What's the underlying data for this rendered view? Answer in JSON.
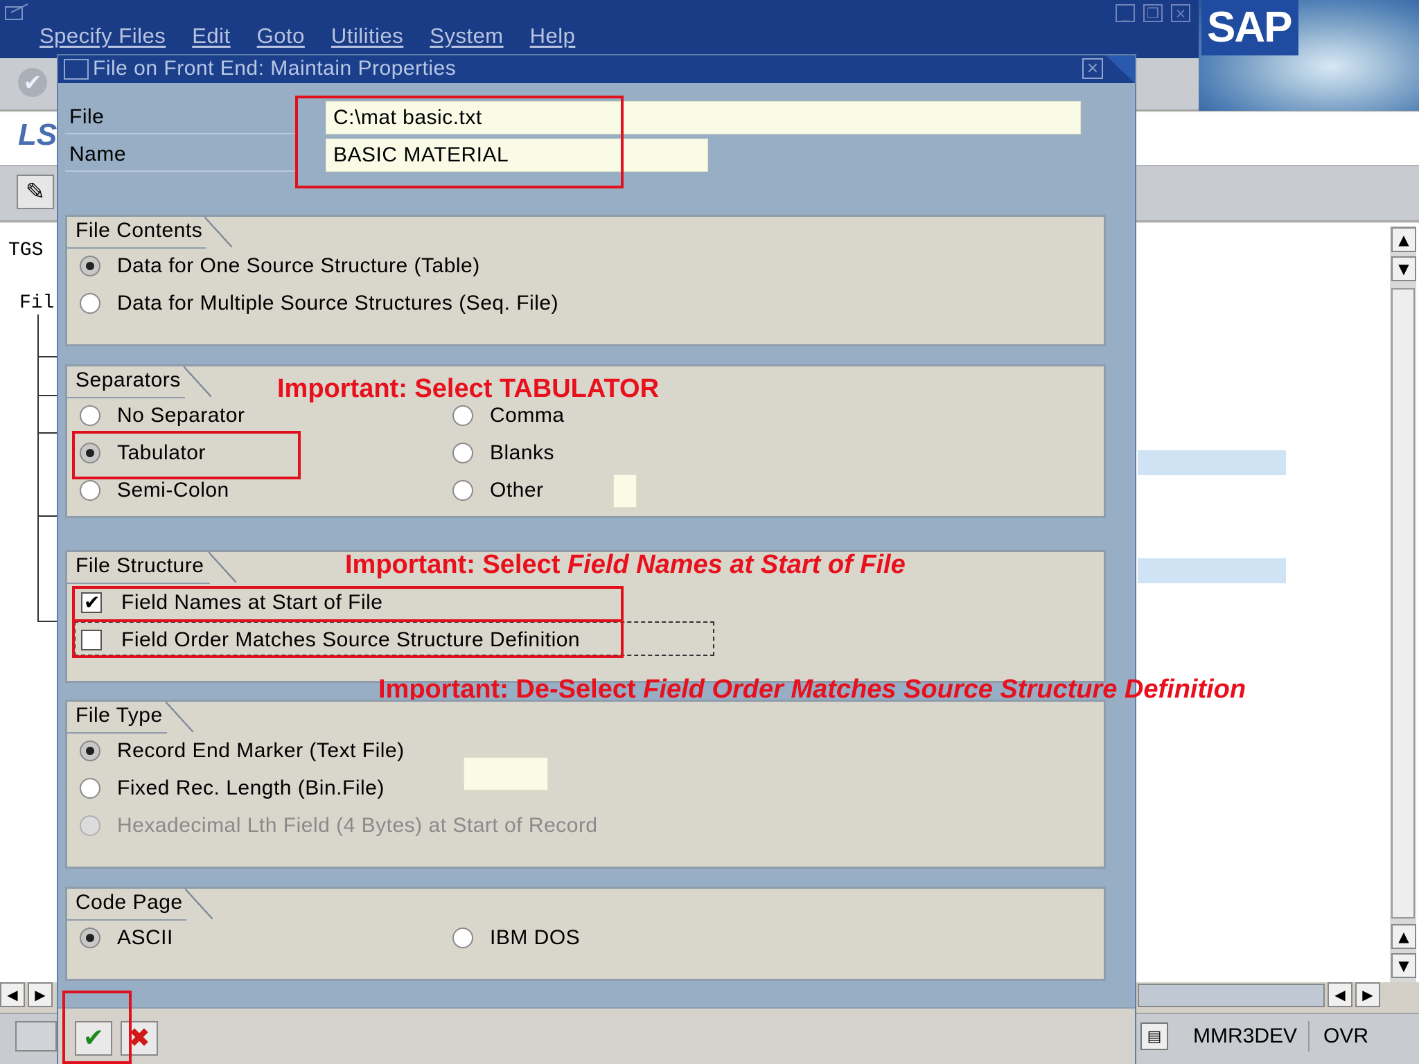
{
  "menu": [
    "Specify Files",
    "Edit",
    "Goto",
    "Utilities",
    "System",
    "Help"
  ],
  "window_controls": [
    "minimize",
    "restore",
    "close"
  ],
  "logo": "SAP",
  "background": {
    "program_title": "LS",
    "tree_label_1": "TGS",
    "tree_label_2": "Fil"
  },
  "dialog": {
    "title": "File on Front End: Maintain Properties",
    "file_label": "File",
    "file_value": "C:\\mat basic.txt",
    "name_label": "Name",
    "name_value": "BASIC MATERIAL",
    "file_contents": {
      "title": "File Contents",
      "options": [
        {
          "label": "Data for One Source Structure (Table)",
          "selected": true
        },
        {
          "label": "Data for Multiple Source Structures (Seq. File)",
          "selected": false
        }
      ]
    },
    "separators": {
      "title": "Separators",
      "options": [
        {
          "label": "No Separator",
          "selected": false
        },
        {
          "label": "Tabulator",
          "selected": true
        },
        {
          "label": "Semi-Colon",
          "selected": false
        },
        {
          "label": "Comma",
          "selected": false
        },
        {
          "label": "Blanks",
          "selected": false
        },
        {
          "label": "Other",
          "selected": false
        }
      ]
    },
    "file_structure": {
      "title": "File Structure",
      "options": [
        {
          "label": "Field Names at Start of File",
          "checked": true
        },
        {
          "label": "Field Order Matches Source Structure Definition",
          "checked": false
        }
      ]
    },
    "file_type": {
      "title": "File Type",
      "options": [
        {
          "label": "Record End Marker (Text File)",
          "selected": true
        },
        {
          "label": "Fixed Rec. Length (Bin.File)",
          "selected": false
        },
        {
          "label": "Hexadecimal Lth Field (4 Bytes) at Start of Record",
          "selected": false,
          "disabled": true
        }
      ]
    },
    "code_page": {
      "title": "Code Page",
      "options": [
        {
          "label": "ASCII",
          "selected": true
        },
        {
          "label": "IBM DOS",
          "selected": false
        }
      ]
    }
  },
  "annotations": {
    "separator_note": "Important: Select TABULATOR",
    "structure_note_prefix": "Important: Select ",
    "structure_note_emph": "Field Names at Start of File",
    "deselect_note_prefix": "Important: De-Select ",
    "deselect_note_emph": "Field Order Matches Source Structure Definition"
  },
  "status_bar": {
    "system": "MMR3DEV",
    "mode": "OVR"
  },
  "colors": {
    "annotation_red": "#e8101c",
    "dialog_title_bg": "#1c3f8c",
    "input_bg": "#fafbe6"
  }
}
